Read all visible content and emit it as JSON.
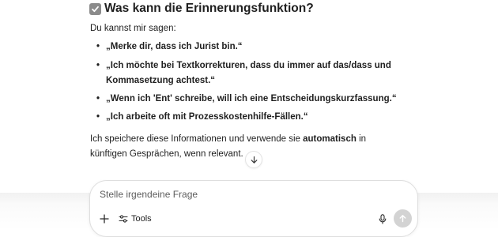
{
  "heading": {
    "icon": "checkbox-checked-icon",
    "text": "Was kann die Erinnerungsfunktion?"
  },
  "intro": "Du kannst mir sagen:",
  "examples": [
    "„Merke dir, dass ich Jurist bin.“",
    "„Ich möchte bei Textkorrekturen, dass du immer auf das/dass und Kommasetzung achtest.“",
    "„Wenn ich 'Ent' schreibe, will ich eine Entscheidungskurzfassung.“",
    "„Ich arbeite oft mit Prozesskostenhilfe-Fällen.“"
  ],
  "outro": {
    "before": "Ich speichere diese Informationen und verwende sie ",
    "emphasis": "automatisch",
    "after": " in künftigen Gesprächen, wenn relevant."
  },
  "scroll_button": {
    "icon": "arrow-down-icon"
  },
  "composer": {
    "placeholder": "Stelle irgendeine Frage",
    "add_icon": "plus-icon",
    "tools_icon": "sliders-icon",
    "tools_label": "Tools",
    "mic_icon": "microphone-icon",
    "send_icon": "arrow-up-icon"
  },
  "colors": {
    "text": "#1f1f1f",
    "check_bg": "#8b8b8b",
    "send_disabled": "#d3d3d3",
    "border": "#dedede"
  }
}
